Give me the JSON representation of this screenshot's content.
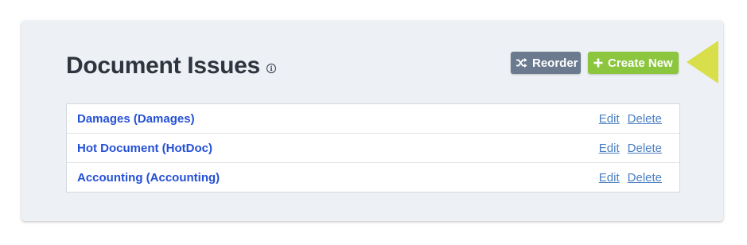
{
  "page": {
    "title": "Document Issues",
    "info_icon": "info-icon"
  },
  "toolbar": {
    "reorder_label": "Reorder",
    "reorder_icon": "shuffle-icon",
    "create_label": "Create New",
    "create_icon": "plus-icon"
  },
  "issues": [
    {
      "name": "Damages (Damages)",
      "edit_label": "Edit",
      "delete_label": "Delete"
    },
    {
      "name": "Hot Document (HotDoc)",
      "edit_label": "Edit",
      "delete_label": "Delete"
    },
    {
      "name": "Accounting (Accounting)",
      "edit_label": "Edit",
      "delete_label": "Delete"
    }
  ],
  "colors": {
    "panel_bg": "#edf0f4",
    "reorder_button": "#6b7a8f",
    "create_button": "#8cc63f",
    "callout_arrow": "#d8df4a",
    "issue_link": "#2450d6",
    "action_link": "#4a7fc1"
  }
}
